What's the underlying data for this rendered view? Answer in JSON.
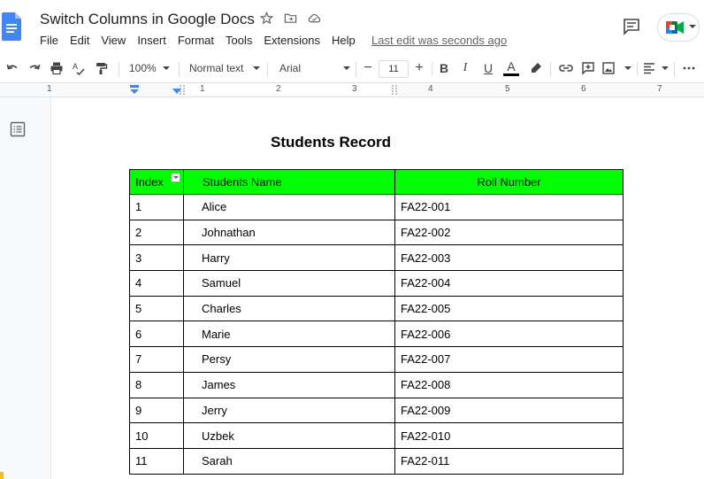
{
  "app": {
    "doc_title": "Switch Columns in Google Docs",
    "last_edit": "Last edit was seconds ago"
  },
  "menu": [
    "File",
    "Edit",
    "View",
    "Insert",
    "Format",
    "Tools",
    "Extensions",
    "Help"
  ],
  "toolbar": {
    "zoom": "100%",
    "style": "Normal text",
    "font": "Arial",
    "font_size": "11",
    "minus": "−",
    "plus": "+",
    "bold": "B",
    "italic": "I",
    "underline": "U",
    "text_color": "A"
  },
  "ruler": {
    "numbers": [
      "1",
      "1",
      "2",
      "3",
      "4",
      "5",
      "6",
      "7"
    ]
  },
  "document": {
    "heading": "Students Record",
    "table": {
      "headers": [
        "Index",
        "Students Name",
        "Roll Number"
      ],
      "rows": [
        [
          "1",
          "Alice",
          "FA22-001"
        ],
        [
          "2",
          "Johnathan",
          "FA22-002"
        ],
        [
          "3",
          "Harry",
          "FA22-003"
        ],
        [
          "4",
          "Samuel",
          "FA22-004"
        ],
        [
          "5",
          "Charles",
          "FA22-005"
        ],
        [
          "6",
          "Marie",
          "FA22-006"
        ],
        [
          "7",
          "Persy",
          "FA22-007"
        ],
        [
          "8",
          "James",
          "FA22-008"
        ],
        [
          "9",
          "Jerry",
          "FA22-009"
        ],
        [
          "10",
          "Uzbek",
          "FA22-010"
        ],
        [
          "11",
          "Sarah",
          "FA22-011"
        ]
      ]
    }
  },
  "colors": {
    "header_fill": "#00ff00",
    "docs_blue": "#4285f4"
  }
}
